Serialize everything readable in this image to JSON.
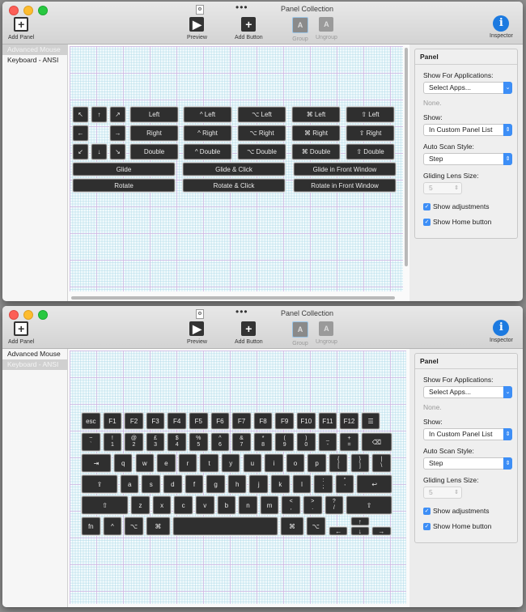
{
  "windows": [
    {
      "title": "Panel Collection",
      "more_label": "•••",
      "toolbar": {
        "add_panel": "Add Panel",
        "preview": "Preview",
        "add_button": "Add Button",
        "group": "Group",
        "ungroup": "Ungroup",
        "inspector": "Inspector"
      },
      "sidebar": {
        "items": [
          {
            "label": "Advanced Mouse",
            "selected": true
          },
          {
            "label": "Keyboard - ANSI",
            "selected": false
          }
        ]
      },
      "mouse_panel": {
        "arrows": [
          "↖",
          "↑",
          "↗",
          "←",
          "→",
          "↙",
          "↓",
          "↘"
        ],
        "click_rows": [
          [
            "Left",
            "^ Left",
            "⌥ Left",
            "⌘ Left",
            "⇧ Left"
          ],
          [
            "Right",
            "^ Right",
            "⌥ Right",
            "⌘ Right",
            "⇧ Right"
          ],
          [
            "Double",
            "^ Double",
            "⌥ Double",
            "⌘ Double",
            "⇧ Double"
          ]
        ],
        "wide_rows": [
          [
            "Glide",
            "Glide & Click",
            "Glide in Front Window"
          ],
          [
            "Rotate",
            "Rotate & Click",
            "Rotate in Front Window"
          ]
        ]
      }
    },
    {
      "title": "Panel Collection",
      "more_label": "•••",
      "toolbar": {
        "add_panel": "Add Panel",
        "preview": "Preview",
        "add_button": "Add Button",
        "group": "Group",
        "ungroup": "Ungroup",
        "inspector": "Inspector"
      },
      "sidebar": {
        "items": [
          {
            "label": "Advanced Mouse",
            "selected": false
          },
          {
            "label": "Keyboard - ANSI",
            "selected": true
          }
        ]
      },
      "keyboard": {
        "row0": [
          "esc",
          "F1",
          "F2",
          "F3",
          "F4",
          "F5",
          "F6",
          "F7",
          "F8",
          "F9",
          "F10",
          "F11",
          "F12",
          "☰"
        ],
        "row1": [
          [
            "~",
            "`"
          ],
          [
            "!",
            "1"
          ],
          [
            "@",
            "2"
          ],
          [
            "£",
            "3"
          ],
          [
            "$",
            "4"
          ],
          [
            "%",
            "5"
          ],
          [
            "^",
            "6"
          ],
          [
            "&",
            "7"
          ],
          [
            "*",
            "8"
          ],
          [
            "(",
            "9"
          ],
          [
            ")",
            "0"
          ],
          [
            "_",
            "-"
          ],
          [
            "+",
            "="
          ],
          [
            "⌫",
            ""
          ]
        ],
        "row2": [
          "⇥",
          "q",
          "w",
          "e",
          "r",
          "t",
          "y",
          "u",
          "i",
          "o",
          "p",
          [
            "{",
            "["
          ],
          [
            "}",
            "]"
          ],
          [
            "|",
            "\\"
          ]
        ],
        "row3": [
          "⇪",
          "a",
          "s",
          "d",
          "f",
          "g",
          "h",
          "j",
          "k",
          "l",
          [
            ":",
            ";"
          ],
          [
            "\"",
            "'"
          ],
          "↩"
        ],
        "row4": [
          "⇧",
          "z",
          "x",
          "c",
          "v",
          "b",
          "n",
          "m",
          [
            "<",
            ","
          ],
          [
            ">",
            "."
          ],
          [
            "?",
            "/"
          ],
          "⇧"
        ],
        "row5": [
          "fn",
          "^",
          "⌥",
          "⌘",
          "",
          "⌘",
          "⌥"
        ],
        "arrows": [
          "↑",
          "←",
          "↓",
          "→"
        ]
      }
    }
  ],
  "inspector": {
    "header": "Panel",
    "show_for_apps_label": "Show For Applications:",
    "show_for_apps_value": "Select Apps...",
    "apps_none": "None.",
    "show_label": "Show:",
    "show_value": "In Custom Panel List",
    "scan_label": "Auto Scan Style:",
    "scan_value": "Step",
    "lens_label": "Gliding Lens Size:",
    "lens_value": "5",
    "show_adjustments": "Show adjustments",
    "show_adjustments_checked": true,
    "show_home": "Show Home button",
    "show_home_checked": true
  },
  "colors": {
    "accent": "#3d8ef6",
    "key_bg": "#2f2f2f",
    "info_blue": "#1c7ae0"
  }
}
